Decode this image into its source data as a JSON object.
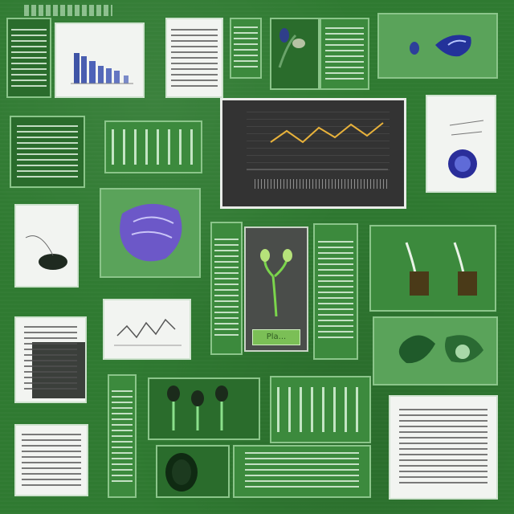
{
  "artwork": {
    "background_color": "#2f7a31",
    "frame_color": "#8bc58a",
    "sign_text": "Pla..."
  },
  "panels": [
    {
      "name": "bar-chart-card",
      "kind": "bar chart on paper",
      "bar_color": "#3f54a6"
    },
    {
      "name": "line-chart-card",
      "kind": "dark line chart",
      "line_color": "#e8b23b"
    },
    {
      "name": "purple-specimen-card",
      "kind": "purple leaf specimen",
      "color": "#6c58c8"
    },
    {
      "name": "plant-sample-card",
      "kind": "seedling sample with sign"
    },
    {
      "name": "sprout-tubes-card",
      "kind": "sprouts in tubes"
    },
    {
      "name": "mini-line-chart-card",
      "kind": "grey line chart on paper"
    }
  ]
}
